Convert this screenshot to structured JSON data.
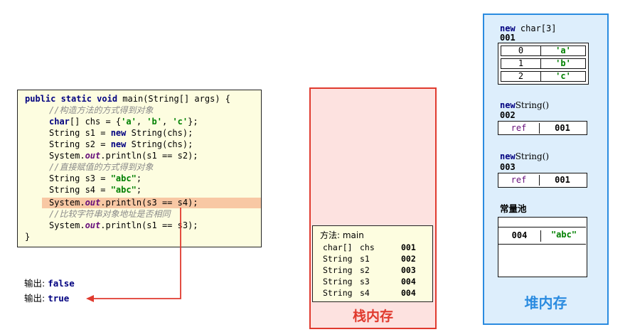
{
  "code": {
    "line1_kw": "public static void",
    "line1_rest": " main(String[] args) {",
    "comment1": "//构造方法的方式得到对象",
    "line3_kw": "char",
    "line3_a": "[] chs = {",
    "line3_c1": "'a'",
    "line3_c2": "'b'",
    "line3_c3": "'c'",
    "line3_end": "};",
    "line4_a": "String s1 = ",
    "line4_kw": "new",
    "line4_b": " String(chs);",
    "line5_a": "String s2 = ",
    "line5_kw": "new",
    "line5_b": " String(chs);",
    "line6_a": "System.",
    "line6_out": "out",
    "line6_b": ".println(s1 == s2);",
    "comment2": "//直接赋值的方式得到对象",
    "line8_a": "String s3 = ",
    "line8_str": "\"abc\"",
    "line8_end": ";",
    "line9_a": "String s4 = ",
    "line9_str": "\"abc\"",
    "line9_end": ";",
    "line10_a": "System.",
    "line10_out": "out",
    "line10_b": ".println(s3 == s4);",
    "comment3": "//比较字符串对象地址是否相同",
    "line12_a": "System.",
    "line12_out": "out",
    "line12_b": ".println(s1 == s3);",
    "close": "}"
  },
  "output": {
    "label1": "输出: ",
    "value1": "false",
    "label2": "输出: ",
    "value2": "true"
  },
  "stack": {
    "label": "栈内存",
    "frame_title": "方法: main",
    "rows": [
      {
        "type": "char[]",
        "name": "chs",
        "addr": "001"
      },
      {
        "type": "String",
        "name": "s1",
        "addr": "002"
      },
      {
        "type": "String",
        "name": "s2",
        "addr": "003"
      },
      {
        "type": "String",
        "name": "s3",
        "addr": "004"
      },
      {
        "type": "String",
        "name": "s4",
        "addr": "004"
      }
    ],
    "border_color": "#e03a2e"
  },
  "heap": {
    "label": "堆内存",
    "char_array": {
      "kw": "new",
      "title_rest": " char[3]",
      "addr": "001",
      "rows": [
        {
          "index": "0",
          "value": "'a'"
        },
        {
          "index": "1",
          "value": "'b'"
        },
        {
          "index": "2",
          "value": "'c'"
        }
      ]
    },
    "string1": {
      "kw": "new",
      "title_rest": "String()",
      "addr": "002",
      "ref": "ref",
      "ref_addr": "001"
    },
    "string2": {
      "kw": "new",
      "title_rest": "String()",
      "addr": "003",
      "ref": "ref",
      "ref_addr": "001"
    },
    "pool": {
      "title": "常量池",
      "addr": "004",
      "value": "\"abc\""
    },
    "border_color": "#2a8be0"
  }
}
